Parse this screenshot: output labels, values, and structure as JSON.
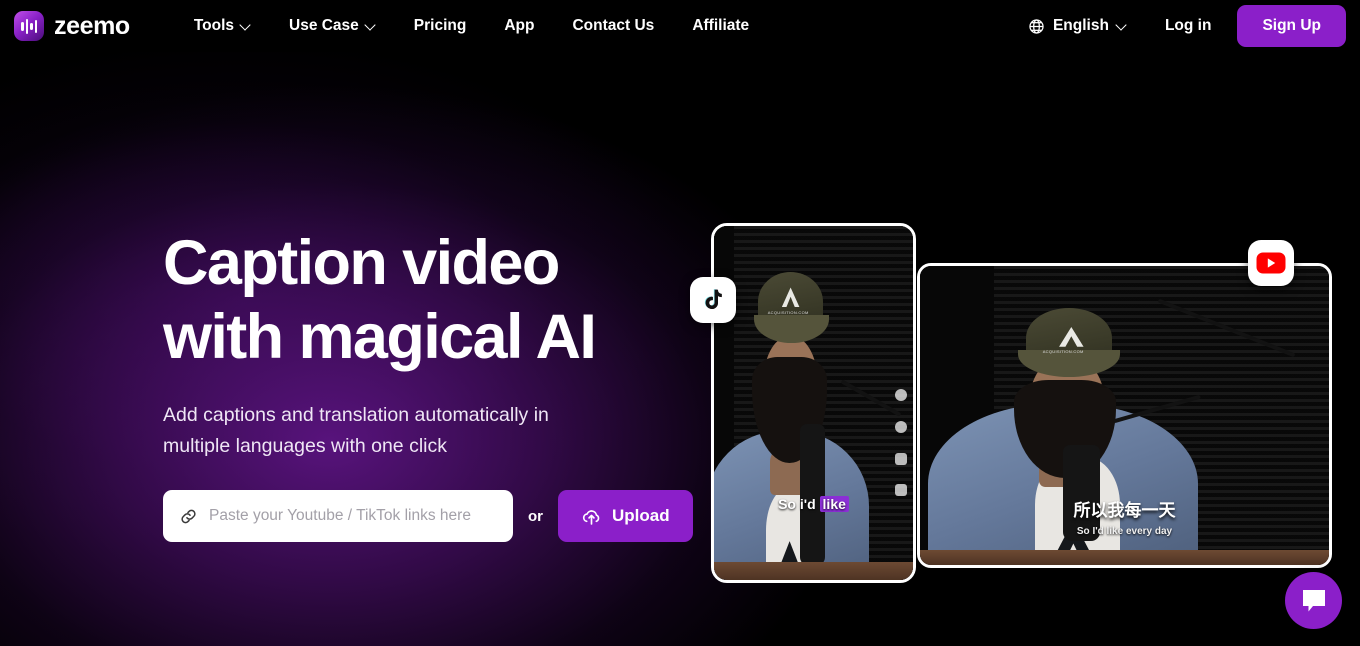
{
  "brand": {
    "name": "zeemo",
    "logo_icon": "waveform-logo-icon"
  },
  "nav": {
    "items": [
      {
        "label": "Tools",
        "has_dropdown": true
      },
      {
        "label": "Use Case",
        "has_dropdown": true
      },
      {
        "label": "Pricing",
        "has_dropdown": false
      },
      {
        "label": "App",
        "has_dropdown": false
      },
      {
        "label": "Contact Us",
        "has_dropdown": false
      },
      {
        "label": "Affiliate",
        "has_dropdown": false
      }
    ],
    "language": {
      "label": "English",
      "icon": "globe-icon"
    },
    "login_label": "Log in",
    "signup_label": "Sign Up"
  },
  "hero": {
    "title": "Caption video\nwith magical AI",
    "subtitle": "Add captions and translation automatically in\nmultiple languages with one click",
    "url_input": {
      "value": "",
      "placeholder": "Paste your Youtube / TikTok links here",
      "icon": "link-icon"
    },
    "separator_label": "or",
    "upload_label": "Upload",
    "upload_icon": "cloud-upload-icon"
  },
  "preview": {
    "tiktok_badge": "tiktok-icon",
    "youtube_badge": "youtube-icon",
    "left_video": {
      "caption_prefix": "So i'd ",
      "caption_highlight": "like",
      "cap_text": "ACQUISITION.COM"
    },
    "right_video": {
      "caption_zh": "所以我每一天",
      "caption_en": "So I'd like every day",
      "cap_text": "ACQUISITION.COM"
    }
  },
  "chat": {
    "icon": "chat-bubble-icon"
  },
  "colors": {
    "accent_purple": "#8b1fc9",
    "caption_highlight": "#8b2fd6",
    "background": "#000000",
    "glow_purple": "#5c1482",
    "youtube_red": "#ff0000"
  }
}
